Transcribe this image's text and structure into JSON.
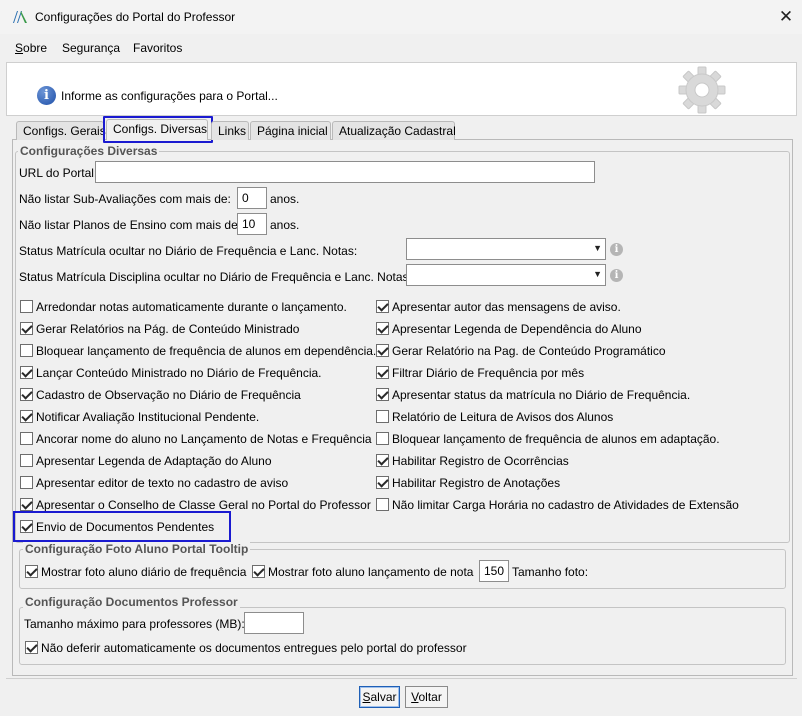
{
  "window": {
    "title": "Configurações do Portal do Professor",
    "close_glyph": "✕"
  },
  "menu": [
    "Sobre",
    "Segurança",
    "Favoritos"
  ],
  "header": {
    "text": "Informe as configurações para o Portal...",
    "info_glyph": "i"
  },
  "tabs": [
    "Configs. Gerais",
    "Configs. Diversas",
    "Links",
    "Página inicial",
    "Atualização Cadastral"
  ],
  "active_tab": "Configs. Diversas",
  "diversas": {
    "legend": "Configurações Diversas",
    "url_label": "URL do Portal:",
    "url_value": "",
    "sub_av_label": "Não listar Sub-Avaliações com mais de:",
    "sub_av_value": "0",
    "sub_av_unit": "anos.",
    "planos_label": "Não listar Planos de Ensino com mais de:",
    "planos_value": "10",
    "planos_unit": "anos.",
    "status_freq_label": "Status Matrícula ocultar no Diário de Frequência e Lanc. Notas:",
    "status_freq_value": "",
    "status_disc_label": "Status Matrícula Disciplina ocultar no Diário de Frequência e Lanc. Notas:",
    "status_disc_value": "",
    "hint_glyph": "i"
  },
  "checks_left": [
    {
      "label": "Arredondar notas automaticamente durante o lançamento.",
      "checked": false
    },
    {
      "label": "Gerar Relatórios na Pág. de Conteúdo Ministrado",
      "checked": true
    },
    {
      "label": "Bloquear lançamento de frequência de alunos em dependência.",
      "checked": false
    },
    {
      "label": "Lançar Conteúdo Ministrado no Diário de Frequência.",
      "checked": true
    },
    {
      "label": "Cadastro de Observação no Diário de Frequência",
      "checked": true
    },
    {
      "label": "Notificar Avaliação Institucional Pendente.",
      "checked": true
    },
    {
      "label": "Ancorar nome do aluno no Lançamento de Notas e Frequência",
      "checked": false
    },
    {
      "label": "Apresentar Legenda de Adaptação do Aluno",
      "checked": false
    },
    {
      "label": "Apresentar editor de texto no cadastro de aviso",
      "checked": false
    },
    {
      "label": "Apresentar o Conselho de Classe Geral no Portal do Professor",
      "checked": true
    },
    {
      "label": "Envio de Documentos Pendentes",
      "checked": true
    }
  ],
  "checks_right": [
    {
      "label": "Apresentar autor das mensagens de aviso.",
      "checked": true
    },
    {
      "label": "Apresentar Legenda de Dependência do Aluno",
      "checked": true
    },
    {
      "label": "Gerar Relatório na Pag. de Conteúdo Programático",
      "checked": true
    },
    {
      "label": "Filtrar Diário de Frequência por mês",
      "checked": true
    },
    {
      "label": "Apresentar status da matrícula no Diário de Frequência.",
      "checked": true
    },
    {
      "label": "Relatório de Leitura de Avisos dos Alunos",
      "checked": false
    },
    {
      "label": "Bloquear lançamento de frequência de alunos em adaptação.",
      "checked": false
    },
    {
      "label": "Habilitar Registro de Ocorrências",
      "checked": true
    },
    {
      "label": "Habilitar Registro de Anotações",
      "checked": true
    },
    {
      "label": "Não limitar Carga Horária no cadastro de Atividades de Extensão",
      "checked": false
    }
  ],
  "foto": {
    "legend": "Configuração Foto Aluno Portal Tooltip",
    "diario_label": "Mostrar foto aluno diário de frequência",
    "diario_checked": true,
    "nota_label": "Mostrar foto aluno lançamento de nota",
    "nota_checked": true,
    "size_value": "150",
    "size_label": "Tamanho foto:"
  },
  "docs": {
    "legend": "Configuração Documentos Professor",
    "max_label": "Tamanho máximo para professores (MB):",
    "max_value": "",
    "defer_label": "Não deferir automaticamente os documentos entregues pelo portal do professor",
    "defer_checked": true
  },
  "buttons": {
    "save_prefix": "S",
    "save_rest": "alvar",
    "back_prefix": "V",
    "back_rest": "oltar"
  },
  "colors": {
    "highlight": "#1a1ad0",
    "window_bg": "#f0f0f0"
  }
}
